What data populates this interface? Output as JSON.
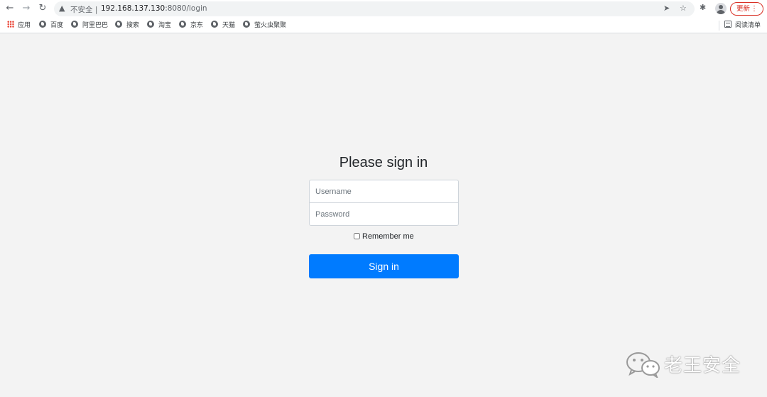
{
  "browser": {
    "url_host": "192.168.137.130",
    "url_path": ":8080/login",
    "security_label": "不安全",
    "update_label": "更新",
    "icons": [
      "back-icon",
      "forward-icon",
      "reload-icon",
      "warning-icon",
      "send-icon",
      "star-icon",
      "extensions-icon",
      "profile-icon",
      "menu-icon"
    ]
  },
  "bookmarks": {
    "apps_label": "应用",
    "items": [
      {
        "label": "百度"
      },
      {
        "label": "阿里巴巴"
      },
      {
        "label": "搜索"
      },
      {
        "label": "淘宝"
      },
      {
        "label": "京东"
      },
      {
        "label": "天猫"
      },
      {
        "label": "萤火虫聚聚"
      }
    ],
    "reading_list_label": "阅读清单"
  },
  "login": {
    "title": "Please sign in",
    "username_placeholder": "Username",
    "password_placeholder": "Password",
    "remember_label": "Remember me",
    "submit_label": "Sign in"
  },
  "watermark": {
    "text": "老王安全"
  },
  "colors": {
    "page_bg": "#f3f3f3",
    "primary": "#007bff",
    "update_red": "#d93025"
  }
}
